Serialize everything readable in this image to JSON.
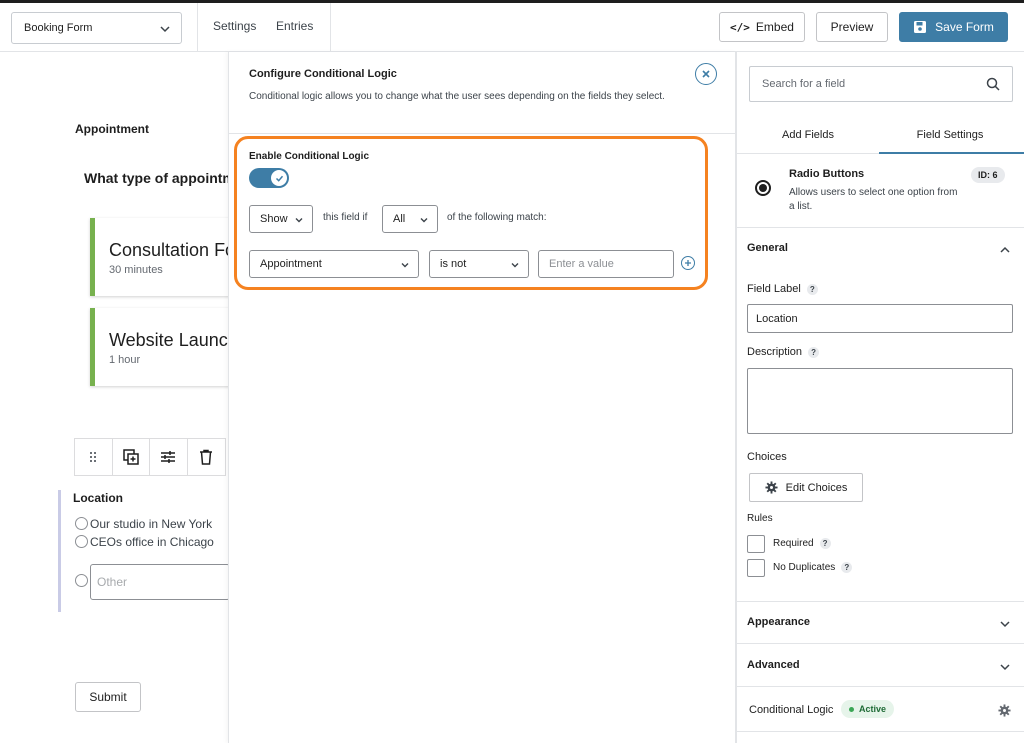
{
  "topbar": {
    "form_select": "Booking Form",
    "nav": [
      "Settings",
      "Entries"
    ],
    "embed_label": "Embed",
    "preview_label": "Preview",
    "save_label": "Save Form"
  },
  "canvas": {
    "section_title": "Appointment",
    "question": "What type of appointment",
    "choices": [
      {
        "title": "Consultation Form",
        "subtitle": "30 minutes"
      },
      {
        "title": "Website Launch",
        "subtitle": "1 hour"
      }
    ],
    "location_label": "Location",
    "location_options": [
      "Our studio in New York",
      "CEOs office in Chicago"
    ],
    "other_placeholder": "Other",
    "submit_label": "Submit"
  },
  "modal": {
    "title": "Configure Conditional Logic",
    "description": "Conditional logic allows you to change what the user sees depending on the fields they select.",
    "enable_label": "Enable Conditional Logic",
    "toggle_on": true,
    "action": "Show",
    "this_field_if": "this field if",
    "match": "All",
    "of_following": "of the following match:",
    "rule": {
      "field": "Appointment",
      "operator": "is not",
      "value_placeholder": "Enter a value"
    },
    "highlight_color": "#f58220"
  },
  "sidebar": {
    "search_placeholder": "Search for a field",
    "tabs": [
      "Add Fields",
      "Field Settings"
    ],
    "active_tab": "Field Settings",
    "field_type": {
      "name": "Radio Buttons",
      "description": "Allows users to select one option from a list.",
      "id_badge": "ID: 6"
    },
    "general": {
      "title": "General",
      "field_label_caption": "Field Label",
      "field_label_value": "Location",
      "description_caption": "Description",
      "choices_caption": "Choices",
      "edit_choices_label": "Edit Choices",
      "rules_caption": "Rules",
      "rules": [
        "Required",
        "No Duplicates"
      ]
    },
    "appearance_title": "Appearance",
    "advanced_title": "Advanced",
    "conditional_logic_title": "Conditional Logic",
    "conditional_logic_status": "Active"
  },
  "colors": {
    "primary": "#3e7da6",
    "choice_accent": "#77b14e",
    "active_green": "#3aa655"
  }
}
